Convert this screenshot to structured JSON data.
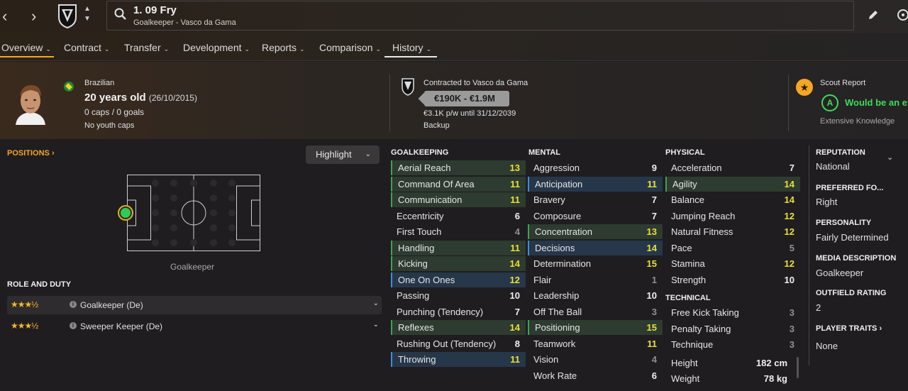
{
  "topbar": {
    "player_name": "1. 09 Fry",
    "player_sub": "Goalkeeper - Vasco da Gama"
  },
  "tabs": [
    {
      "label": "Overview"
    },
    {
      "label": "Contract"
    },
    {
      "label": "Transfer"
    },
    {
      "label": "Development"
    },
    {
      "label": "Reports"
    },
    {
      "label": "Comparison"
    },
    {
      "label": "History"
    }
  ],
  "header": {
    "nationality": "Brazilian",
    "age": "20 years old",
    "dob": "(26/10/2015)",
    "caps": "0 caps / 0 goals",
    "youth_caps": "No youth caps",
    "contract_title": "Contracted to Vasco da Gama",
    "value_range": "€190K - €1.9M",
    "wage": "€3.1K p/w until 31/12/2039",
    "squad_status": "Backup",
    "scout_title": "Scout Report",
    "scout_grade": "A",
    "scout_verdict": "Would be an ex",
    "scout_knowledge": "Extensive Knowledge"
  },
  "positions": {
    "title": "POSITIONS ›",
    "highlight_label": "Highlight",
    "position_name": "Goalkeeper"
  },
  "roles": {
    "title": "ROLE AND DUTY",
    "items": [
      {
        "label": "Goalkeeper (De)",
        "stars": "★★★½"
      },
      {
        "label": "Sweeper Keeper (De)",
        "stars": "★★★½"
      }
    ]
  },
  "goalkeeping": {
    "title": "GOALKEEPING",
    "rows": [
      {
        "name": "Aerial Reach",
        "value": "13"
      },
      {
        "name": "Command Of Area",
        "value": "11"
      },
      {
        "name": "Communication",
        "value": "11"
      },
      {
        "name": "Eccentricity",
        "value": "6"
      },
      {
        "name": "First Touch",
        "value": "4"
      },
      {
        "name": "Handling",
        "value": "11"
      },
      {
        "name": "Kicking",
        "value": "14"
      },
      {
        "name": "One On Ones",
        "value": "12"
      },
      {
        "name": "Passing",
        "value": "10"
      },
      {
        "name": "Punching (Tendency)",
        "value": "7"
      },
      {
        "name": "Reflexes",
        "value": "14"
      },
      {
        "name": "Rushing Out (Tendency)",
        "value": "8"
      },
      {
        "name": "Throwing",
        "value": "11"
      }
    ]
  },
  "mental": {
    "title": "MENTAL",
    "rows": [
      {
        "name": "Aggression",
        "value": "9"
      },
      {
        "name": "Anticipation",
        "value": "11"
      },
      {
        "name": "Bravery",
        "value": "7"
      },
      {
        "name": "Composure",
        "value": "7"
      },
      {
        "name": "Concentration",
        "value": "13"
      },
      {
        "name": "Decisions",
        "value": "14"
      },
      {
        "name": "Determination",
        "value": "15"
      },
      {
        "name": "Flair",
        "value": "1"
      },
      {
        "name": "Leadership",
        "value": "10"
      },
      {
        "name": "Off The Ball",
        "value": "3"
      },
      {
        "name": "Positioning",
        "value": "15"
      },
      {
        "name": "Teamwork",
        "value": "11"
      },
      {
        "name": "Vision",
        "value": "4"
      },
      {
        "name": "Work Rate",
        "value": "6"
      }
    ]
  },
  "physical": {
    "title": "PHYSICAL",
    "rows": [
      {
        "name": "Acceleration",
        "value": "7"
      },
      {
        "name": "Agility",
        "value": "14"
      },
      {
        "name": "Balance",
        "value": "14"
      },
      {
        "name": "Jumping Reach",
        "value": "12"
      },
      {
        "name": "Natural Fitness",
        "value": "12"
      },
      {
        "name": "Pace",
        "value": "5"
      },
      {
        "name": "Stamina",
        "value": "12"
      },
      {
        "name": "Strength",
        "value": "10"
      }
    ]
  },
  "technical": {
    "title": "TECHNICAL",
    "rows": [
      {
        "name": "Free Kick Taking",
        "value": "3"
      },
      {
        "name": "Penalty Taking",
        "value": "3"
      },
      {
        "name": "Technique",
        "value": "3"
      }
    ]
  },
  "body": {
    "height_label": "Height",
    "height": "182 cm",
    "weight_label": "Weight",
    "weight": "78 kg"
  },
  "side": {
    "reputation_label": "REPUTATION",
    "reputation": "National",
    "foot_label": "PREFERRED FO...",
    "foot": "Right",
    "personality_label": "PERSONALITY",
    "personality": "Fairly Determined",
    "media_label": "MEDIA DESCRIPTION",
    "media": "Goalkeeper",
    "outfield_label": "OUTFIELD RATING",
    "outfield": "2",
    "traits_label": "PLAYER TRAITS ›",
    "traits": "None"
  },
  "colors": {
    "accent_orange": "#f5a623",
    "highlight_green": "#3ea34f",
    "highlight_blue": "#3d8ed8",
    "scout_green": "#3ddc5a"
  }
}
